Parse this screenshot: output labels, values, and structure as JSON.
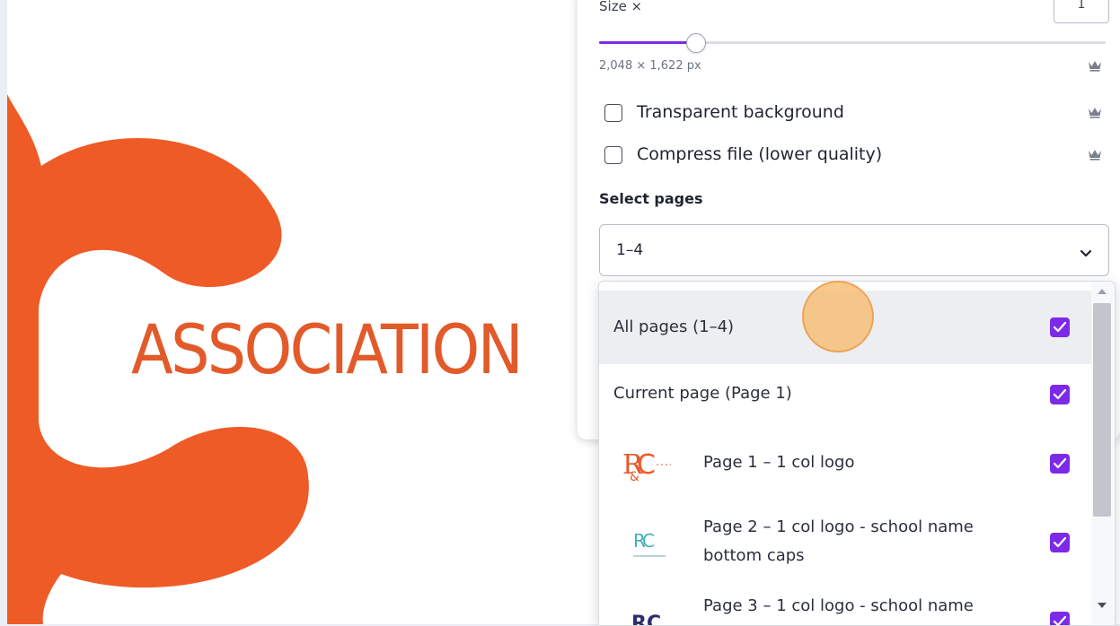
{
  "canvas": {
    "association_text": "ASSOCIATION",
    "brand_color": "#e35a2a"
  },
  "export_panel": {
    "size_label": "Size ×",
    "size_value": "1",
    "slider_value_fraction": 0.19,
    "dimensions": "2,048 × 1,622 px",
    "transparent_background": {
      "label": "Transparent background",
      "checked": false
    },
    "compress_file": {
      "label": "Compress file (lower quality)",
      "checked": false
    },
    "select_pages_label": "Select pages",
    "select_pages_value": "1–4"
  },
  "page_dropdown": {
    "all_pages": {
      "label": "All pages (1–4)",
      "checked": true
    },
    "current_page": {
      "label": "Current page (Page 1)",
      "checked": true
    },
    "pages": [
      {
        "label": "Page 1 – 1 col logo",
        "checked": true
      },
      {
        "label": "Page 2 – 1 col logo - school name bottom caps",
        "checked": true
      },
      {
        "label": "Page 3 – 1 col logo - school name",
        "checked": true
      }
    ]
  },
  "colors": {
    "accent": "#7d2ae8",
    "highlight": "#f7be78"
  },
  "icons": {
    "crown": "crown-icon",
    "chevron": "chevron-down-icon",
    "check": "checkmark-icon"
  }
}
